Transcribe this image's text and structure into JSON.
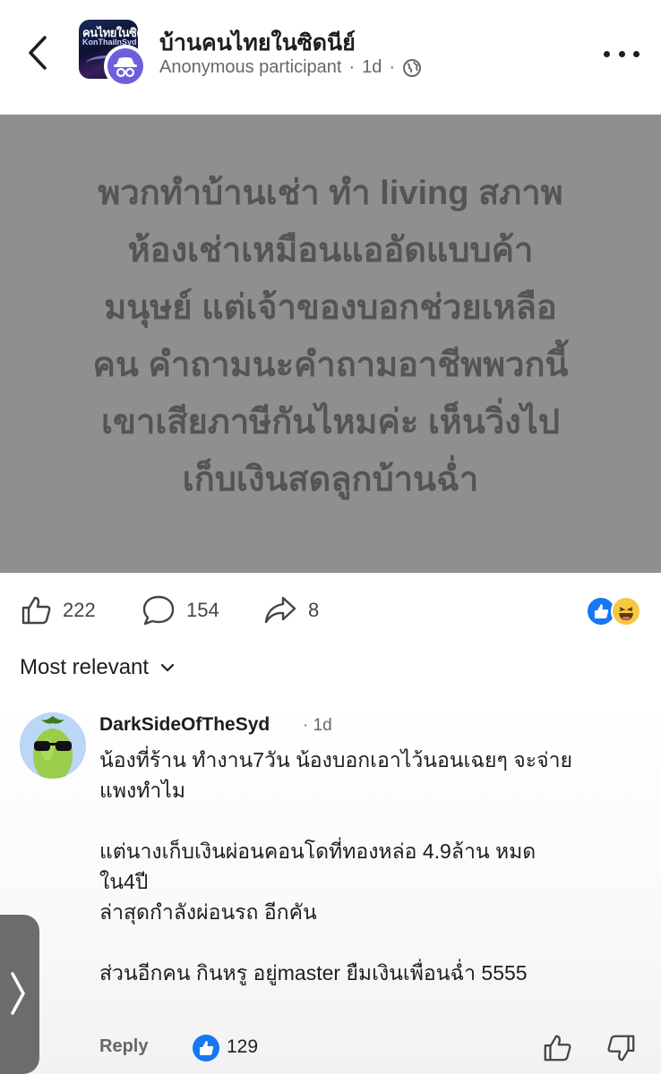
{
  "header": {
    "group_name": "บ้านคนไทยในซิดนีย์",
    "author": "Anonymous participant",
    "separator": "·",
    "time": "1d",
    "thumb_text": "คนไทยในซิด",
    "thumb_subtext": "KonThaiInSyd",
    "icons": {
      "back": "chevron-left-icon",
      "privacy": "globe-icon",
      "more": "more-icon",
      "anon": "anonymous-icon"
    }
  },
  "post": {
    "lines": [
      "พวกทำบ้านเช่า ทำ living สภาพ",
      "ห้องเช่าเหมือนแออัดแบบค้า",
      "มนุษย์ แต่เจ้าของบอกช่วยเหลือ",
      "คน คำถามนะคำถามอาชีพพวกนี้",
      "เขาเสียภาษีกันไหมค่ะ เห็นวิ่งไป",
      "เก็บเงินสดลูกบ้านฉ่ำ"
    ],
    "background": "#8f8f8f"
  },
  "stats": {
    "likes": "222",
    "comments": "154",
    "shares": "8",
    "icons": {
      "like": "like-icon",
      "comment": "comment-icon",
      "share": "share-icon",
      "summary": [
        "like-reaction-icon",
        "haha-reaction-icon"
      ]
    }
  },
  "sort": {
    "label": "Most relevant",
    "icon": "chevron-down-icon"
  },
  "comment": {
    "author": "DarkSideOfTheSyd",
    "separator": "·",
    "time": "1d",
    "paragraphs": [
      [
        "น้องที่ร้าน ทำงาน7วัน น้องบอกเอาไว้นอนเฉยๆ จะจ่าย",
        "แพงทำไม"
      ],
      [
        "แต่นางเก็บเงินผ่อนคอนโดที่ทองหล่อ 4.9ล้าน หมด",
        "ใน4ปี",
        "ล่าสุดกำลังผ่อนรถ อีกคัน"
      ],
      [
        "ส่วนอีกคน กินหรู อยู่master ยืมเงินเพื่อนฉ่ำ 5555"
      ]
    ],
    "reply_label": "Reply",
    "like_count": "129",
    "icons": {
      "like": "like-icon",
      "dislike": "dislike-icon",
      "avatar": "sunglasses-pea-avatar"
    }
  },
  "side_tab": {
    "icon": "chevron-right-icon"
  },
  "colors": {
    "accent": "#1877f2",
    "anon_badge": "#6c5fde",
    "muted": "#65676b",
    "text": "#1c1e21"
  }
}
